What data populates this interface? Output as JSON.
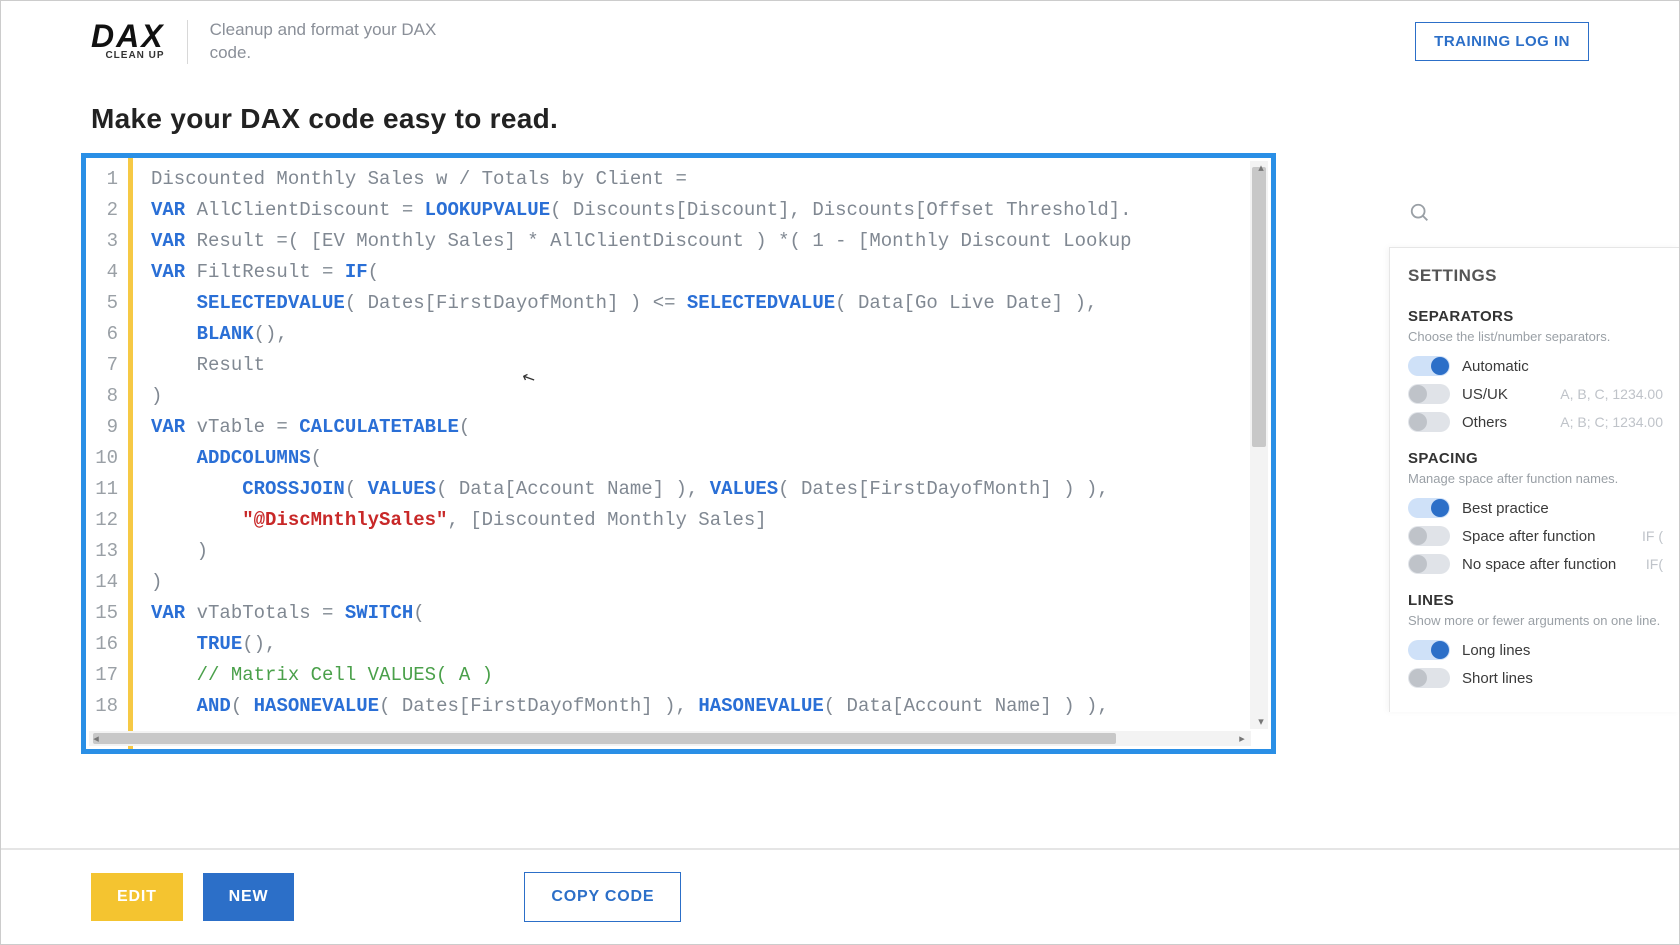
{
  "header": {
    "logo_main": "DAX",
    "logo_sub": "CLEAN UP",
    "tagline": "Cleanup and format your DAX code.",
    "login": "TRAINING LOG IN"
  },
  "heading": "Make your DAX code easy to read.",
  "code": {
    "lines": [
      {
        "n": "1",
        "seg": [
          [
            "",
            "Discounted Monthly Sales w / Totals by Client ="
          ]
        ]
      },
      {
        "n": "2",
        "seg": [
          [
            "kw",
            "VAR"
          ],
          [
            "",
            " AllClientDiscount = "
          ],
          [
            "fn",
            "LOOKUPVALUE"
          ],
          [
            "",
            "( Discounts[Discount], Discounts[Offset Threshold]."
          ]
        ]
      },
      {
        "n": "3",
        "seg": [
          [
            "kw",
            "VAR"
          ],
          [
            "",
            " Result =( [EV Monthly Sales] * AllClientDiscount ) *( 1 - [Monthly Discount Lookup"
          ]
        ]
      },
      {
        "n": "4",
        "seg": [
          [
            "kw",
            "VAR"
          ],
          [
            "",
            " FiltResult = "
          ],
          [
            "fn",
            "IF"
          ],
          [
            "",
            "("
          ]
        ]
      },
      {
        "n": "5",
        "seg": [
          [
            "",
            "    "
          ],
          [
            "fn",
            "SELECTEDVALUE"
          ],
          [
            "",
            "( Dates[FirstDayofMonth] ) <= "
          ],
          [
            "fn",
            "SELECTEDVALUE"
          ],
          [
            "",
            "( Data[Go Live Date] ),"
          ]
        ]
      },
      {
        "n": "6",
        "seg": [
          [
            "",
            "    "
          ],
          [
            "fn",
            "BLANK"
          ],
          [
            "",
            "(),"
          ]
        ]
      },
      {
        "n": "7",
        "seg": [
          [
            "",
            "    Result"
          ]
        ]
      },
      {
        "n": "8",
        "seg": [
          [
            "",
            ")"
          ]
        ]
      },
      {
        "n": "9",
        "seg": [
          [
            "kw",
            "VAR"
          ],
          [
            "",
            " vTable = "
          ],
          [
            "fn",
            "CALCULATETABLE"
          ],
          [
            "",
            "("
          ]
        ]
      },
      {
        "n": "10",
        "seg": [
          [
            "",
            "    "
          ],
          [
            "fn",
            "ADDCOLUMNS"
          ],
          [
            "",
            "("
          ]
        ]
      },
      {
        "n": "11",
        "seg": [
          [
            "",
            "        "
          ],
          [
            "fn",
            "CROSSJOIN"
          ],
          [
            "",
            "( "
          ],
          [
            "fn",
            "VALUES"
          ],
          [
            "",
            "( Data[Account Name] ), "
          ],
          [
            "fn",
            "VALUES"
          ],
          [
            "",
            "( Dates[FirstDayofMonth] ) ),"
          ]
        ]
      },
      {
        "n": "12",
        "seg": [
          [
            "",
            "        "
          ],
          [
            "str",
            "\"@DiscMnthlySales\""
          ],
          [
            "",
            ", [Discounted Monthly Sales]"
          ]
        ]
      },
      {
        "n": "13",
        "seg": [
          [
            "",
            "    )"
          ]
        ]
      },
      {
        "n": "14",
        "seg": [
          [
            "",
            ")"
          ]
        ]
      },
      {
        "n": "15",
        "seg": [
          [
            "kw",
            "VAR"
          ],
          [
            "",
            " vTabTotals = "
          ],
          [
            "fn",
            "SWITCH"
          ],
          [
            "",
            "("
          ]
        ]
      },
      {
        "n": "16",
        "seg": [
          [
            "",
            "    "
          ],
          [
            "fn",
            "TRUE"
          ],
          [
            "",
            "(),"
          ]
        ]
      },
      {
        "n": "17",
        "seg": [
          [
            "",
            "    "
          ],
          [
            "cmt",
            "// Matrix Cell VALUES( A )"
          ]
        ]
      },
      {
        "n": "18",
        "seg": [
          [
            "",
            "    "
          ],
          [
            "fn",
            "AND"
          ],
          [
            "",
            "( "
          ],
          [
            "fn",
            "HASONEVALUE"
          ],
          [
            "",
            "( Dates[FirstDayofMonth] ), "
          ],
          [
            "fn",
            "HASONEVALUE"
          ],
          [
            "",
            "( Data[Account Name] ) ),"
          ]
        ]
      }
    ]
  },
  "buttons": {
    "edit": "EDIT",
    "new": "NEW",
    "copy": "COPY CODE"
  },
  "settings": {
    "title": "SETTINGS",
    "separators": {
      "title": "SEPARATORS",
      "desc": "Choose the list/number separators.",
      "opts": [
        {
          "label": "Automatic",
          "hint": "",
          "on": true
        },
        {
          "label": "US/UK",
          "hint": "A, B, C, 1234.00",
          "on": false
        },
        {
          "label": "Others",
          "hint": "A; B; C; 1234.00",
          "on": false
        }
      ]
    },
    "spacing": {
      "title": "SPACING",
      "desc": "Manage space after function names.",
      "opts": [
        {
          "label": "Best practice",
          "hint": "",
          "on": true
        },
        {
          "label": "Space after function",
          "hint": "IF (",
          "on": false
        },
        {
          "label": "No space after function",
          "hint": "IF(",
          "on": false
        }
      ]
    },
    "lines": {
      "title": "LINES",
      "desc": "Show more or fewer arguments on one line.",
      "opts": [
        {
          "label": "Long lines",
          "hint": "",
          "on": true
        },
        {
          "label": "Short lines",
          "hint": "",
          "on": false
        }
      ]
    }
  }
}
